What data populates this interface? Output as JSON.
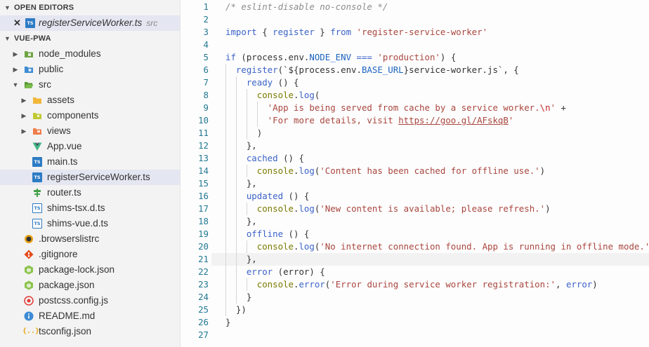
{
  "sidebar": {
    "open_editors": {
      "title": "OPEN EDITORS",
      "items": [
        {
          "name": "registerServiceWorker.ts",
          "sub": "src"
        }
      ]
    },
    "project": {
      "title": "VUE-PWA",
      "items": [
        {
          "name": "node_modules",
          "icon": "folder-icon"
        },
        {
          "name": "public",
          "icon": "folder-icon"
        },
        {
          "name": "src",
          "icon": "folder-open-icon"
        },
        {
          "name": "assets",
          "icon": "folder-icon"
        },
        {
          "name": "components",
          "icon": "folder-icon"
        },
        {
          "name": "views",
          "icon": "folder-icon"
        },
        {
          "name": "App.vue",
          "icon": "vue-icon"
        },
        {
          "name": "main.ts",
          "icon": "typescript-icon",
          "icon_text": "TS"
        },
        {
          "name": "registerServiceWorker.ts",
          "icon": "typescript-icon",
          "icon_text": "TS"
        },
        {
          "name": "router.ts",
          "icon": "router-icon"
        },
        {
          "name": "shims-tsx.d.ts",
          "icon": "typescript-def-icon",
          "icon_text": "TS"
        },
        {
          "name": "shims-vue.d.ts",
          "icon": "typescript-def-icon",
          "icon_text": "TS"
        },
        {
          "name": ".browserslistrc",
          "icon": "browserslist-icon"
        },
        {
          "name": ".gitignore",
          "icon": "git-icon"
        },
        {
          "name": "package-lock.json",
          "icon": "npm-icon"
        },
        {
          "name": "package.json",
          "icon": "npm-icon"
        },
        {
          "name": "postcss.config.js",
          "icon": "postcss-icon"
        },
        {
          "name": "README.md",
          "icon": "info-icon"
        },
        {
          "name": "tsconfig.json",
          "icon": "json-icon",
          "icon_text": "{..}"
        }
      ]
    }
  },
  "editor": {
    "line_numbers": [
      "1",
      "2",
      "3",
      "4",
      "5",
      "6",
      "7",
      "8",
      "9",
      "10",
      "11",
      "12",
      "13",
      "14",
      "15",
      "16",
      "17",
      "18",
      "19",
      "20",
      "21",
      "22",
      "23",
      "24",
      "25",
      "26",
      "27"
    ],
    "lines": [
      [
        {
          "t": "/* eslint-disable no-console */",
          "c": "com"
        }
      ],
      [],
      [
        {
          "t": "import",
          "c": "kw"
        },
        {
          "t": " { "
        },
        {
          "t": "register",
          "c": "fn"
        },
        {
          "t": " } "
        },
        {
          "t": "from",
          "c": "kw"
        },
        {
          "t": " "
        },
        {
          "t": "'register-service-worker'",
          "c": "str"
        }
      ],
      [],
      [
        {
          "t": "if",
          "c": "kw"
        },
        {
          "t": " (process.env."
        },
        {
          "t": "NODE_ENV",
          "c": "const"
        },
        {
          "t": " "
        },
        {
          "t": "===",
          "c": "kw"
        },
        {
          "t": " "
        },
        {
          "t": "'production'",
          "c": "str"
        },
        {
          "t": ") {"
        }
      ],
      [
        {
          "t": "  "
        },
        {
          "t": "register",
          "c": "fn"
        },
        {
          "t": "(`${process.env."
        },
        {
          "t": "BASE_URL",
          "c": "const"
        },
        {
          "t": "}service-worker.js`, {"
        }
      ],
      [
        {
          "t": "    "
        },
        {
          "t": "ready",
          "c": "fn"
        },
        {
          "t": " () {"
        }
      ],
      [
        {
          "t": "      "
        },
        {
          "t": "console",
          "c": "obj"
        },
        {
          "t": "."
        },
        {
          "t": "log",
          "c": "fn"
        },
        {
          "t": "("
        }
      ],
      [
        {
          "t": "        "
        },
        {
          "t": "'App is being served from cache by a service worker.",
          "c": "str"
        },
        {
          "t": "\\n",
          "c": "esc"
        },
        {
          "t": "'",
          "c": "str"
        },
        {
          "t": " +"
        }
      ],
      [
        {
          "t": "        "
        },
        {
          "t": "'For more details, visit ",
          "c": "str"
        },
        {
          "t": "https://goo.gl/AFskqB",
          "c": "url"
        },
        {
          "t": "'",
          "c": "str"
        }
      ],
      [
        {
          "t": "      )"
        }
      ],
      [
        {
          "t": "    },"
        }
      ],
      [
        {
          "t": "    "
        },
        {
          "t": "cached",
          "c": "fn"
        },
        {
          "t": " () {"
        }
      ],
      [
        {
          "t": "      "
        },
        {
          "t": "console",
          "c": "obj"
        },
        {
          "t": "."
        },
        {
          "t": "log",
          "c": "fn"
        },
        {
          "t": "("
        },
        {
          "t": "'Content has been cached for offline use.'",
          "c": "str"
        },
        {
          "t": ")"
        }
      ],
      [
        {
          "t": "    },"
        }
      ],
      [
        {
          "t": "    "
        },
        {
          "t": "updated",
          "c": "fn"
        },
        {
          "t": " () {"
        }
      ],
      [
        {
          "t": "      "
        },
        {
          "t": "console",
          "c": "obj"
        },
        {
          "t": "."
        },
        {
          "t": "log",
          "c": "fn"
        },
        {
          "t": "("
        },
        {
          "t": "'New content is available; please refresh.'",
          "c": "str"
        },
        {
          "t": ")"
        }
      ],
      [
        {
          "t": "    },"
        }
      ],
      [
        {
          "t": "    "
        },
        {
          "t": "offline",
          "c": "fn"
        },
        {
          "t": " () {"
        }
      ],
      [
        {
          "t": "      "
        },
        {
          "t": "console",
          "c": "obj"
        },
        {
          "t": "."
        },
        {
          "t": "log",
          "c": "fn"
        },
        {
          "t": "("
        },
        {
          "t": "'No internet connection found. App is running in offline mode.'",
          "c": "str"
        },
        {
          "t": ")"
        }
      ],
      [
        {
          "t": "    },"
        }
      ],
      [
        {
          "t": "    "
        },
        {
          "t": "error",
          "c": "fn"
        },
        {
          "t": " (error) {"
        }
      ],
      [
        {
          "t": "      "
        },
        {
          "t": "console",
          "c": "obj"
        },
        {
          "t": "."
        },
        {
          "t": "error",
          "c": "fn"
        },
        {
          "t": "("
        },
        {
          "t": "'Error during service worker registration:'",
          "c": "str"
        },
        {
          "t": ", "
        },
        {
          "t": "error",
          "c": "fn"
        },
        {
          "t": ")"
        }
      ],
      [
        {
          "t": "    }"
        }
      ],
      [
        {
          "t": "  })"
        }
      ],
      [
        {
          "t": "}"
        }
      ],
      []
    ],
    "highlighted_line": 21
  },
  "colors": {
    "sidebar_bg": "#f3f3f3",
    "selection_bg": "#e4e6f1",
    "line_number": "#237893",
    "keyword": "#3b62c8",
    "string": "#a9463e",
    "comment": "#8d8d8d"
  }
}
